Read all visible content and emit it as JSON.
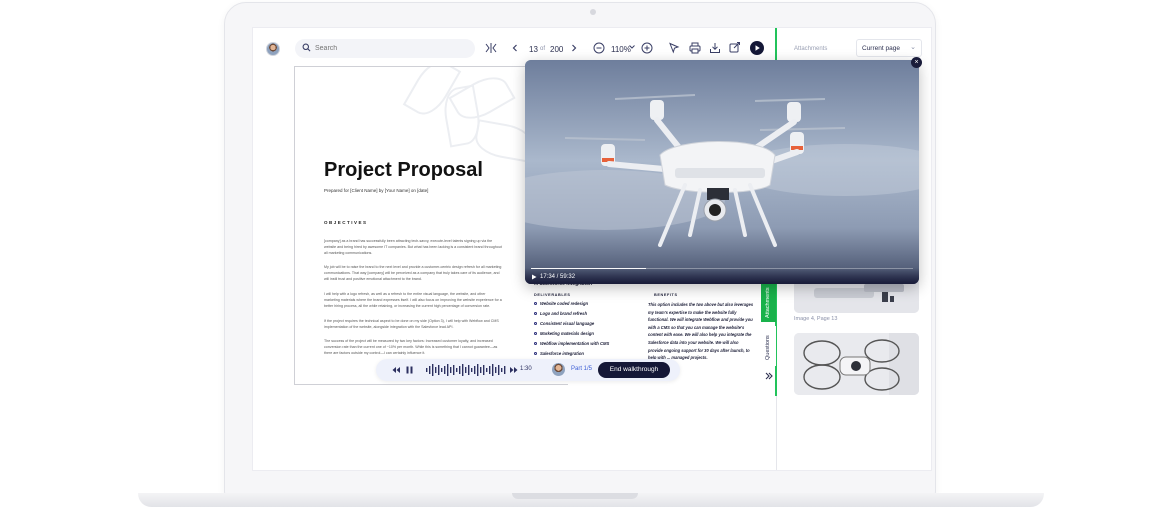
{
  "toolbar": {
    "search_placeholder": "Search",
    "page_current": "13",
    "page_of": "of",
    "page_total": "200",
    "zoom": "110%"
  },
  "panel": {
    "attachments_label": "Attachments",
    "scope_select": "Current page",
    "tab_attachments": "Attachments",
    "tab_questions": "Questions",
    "thumb_caption": "Image 4, Page 13"
  },
  "doc": {
    "title": "Project Proposal",
    "subtitle": "Prepared for [Client Name] by [Your Name] on [date]",
    "objectives_heading": "OBJECTIVES",
    "paragraphs": [
      "[company] as a brand has successfully been attracting tech-savvy, execute-level talents signing up via the website and being hired by awesome IT companies. But what has been lacking is a consistent brand throughout all marketing communications.",
      "My job will be to raise the brand to the next level and provide a customer-centric design refresh for all marketing communications. That way [company] will be perceived as a company that truly takes care of its audience, and will instil trust and positive emotional attachment to the brand.",
      "I will help with a logo refresh, as well as a refresh to the entire visual language, the website, and other marketing materials where the brand expresses itself. I will also focus on improving the website experience for a better hiring process, all the while retaining, or increasing the current high percentage of conversion rate.",
      "If the project requires the technical aspect to be done on my side (Option 3), I will help with Webflow and CMS implementation of the website, alongside integration with the Salesforce lead API.",
      "The success of the project will be measured by two key factors: Increased customer loyalty, and increased conversion rate than the current one of ~10% per month. While this is something that I cannot guarantee—as there are factors outside my control—I can certainly influence it."
    ],
    "page2_heading": "... Salesforce integration",
    "deliverables_label": "DELIVERABLES",
    "benefits_label": "BENEFITS",
    "deliverables": [
      "Website coded redesign",
      "Logo and brand refresh",
      "Consistent visual language",
      "Marketing materials design",
      "Webflow implementation with CMS",
      "Salesforce integration"
    ],
    "benefits_text": "This option includes the two above but also leverages my team's expertise to make the website fully functional. We will integrate Webflow and provide you with a CMS so that you can manage the website's content with ease. We will also help you integrate the Salesforce data into your website. We will also provide ongoing support for 30 days after launch, to help with ... managed projects."
  },
  "video": {
    "time": "17:34 / 59:32",
    "progress": 0.3
  },
  "walkthrough": {
    "time": "1:30",
    "part": "Part 1/5",
    "end_label": "End walkthrough"
  },
  "colors": {
    "accent_green": "#22c35b",
    "dark_navy": "#151837",
    "part_blue": "#3d5fd6"
  }
}
